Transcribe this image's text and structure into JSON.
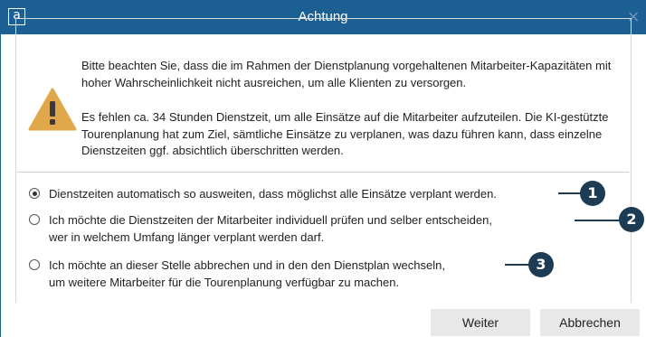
{
  "window": {
    "app_icon_letter": "a",
    "title": "Achtung",
    "close_glyph": "×"
  },
  "message": {
    "paragraph1": "Bitte beachten Sie, dass die im Rahmen der Dienstplanung vorgehaltenen Mitarbeiter-Kapazitäten mit hoher Wahrscheinlichkeit nicht ausreichen, um alle Klienten zu versorgen.",
    "paragraph2": "Es fehlen ca. 34 Stunden Dienstzeit, um alle Einsätze auf die Mitarbeiter aufzuteilen. Die KI-gestützte Tourenplanung hat zum Ziel, sämtliche Einsätze zu verplanen, was dazu führen kann, dass einzelne Dienstzeiten ggf. absichtlich überschritten werden."
  },
  "options": [
    {
      "line1": "Dienstzeiten automatisch so ausweiten, dass möglichst alle Einsätze verplant werden.",
      "selected": true,
      "badge": "1"
    },
    {
      "line1": "Ich möchte die Dienstzeiten der Mitarbeiter individuell prüfen und selber entscheiden,",
      "line2": "wer in welchem Umfang länger verplant werden darf.",
      "selected": false,
      "badge": "2"
    },
    {
      "line1": "Ich möchte an dieser Stelle abbrechen und in den den Dienstplan wechseln,",
      "line2": "um weitere Mitarbeiter für die Tourenplanung verfügbar zu machen.",
      "selected": false,
      "badge": "3"
    }
  ],
  "buttons": {
    "next": "Weiter",
    "cancel": "Abbrechen"
  },
  "colors": {
    "titlebar": "#1c5f93",
    "warning": "#e0a84a",
    "callout": "#1d3c54",
    "button": "#e8e8e8"
  },
  "icons": {
    "warning": "warning-triangle-icon",
    "close": "close-icon",
    "app": "app-logo-icon"
  }
}
